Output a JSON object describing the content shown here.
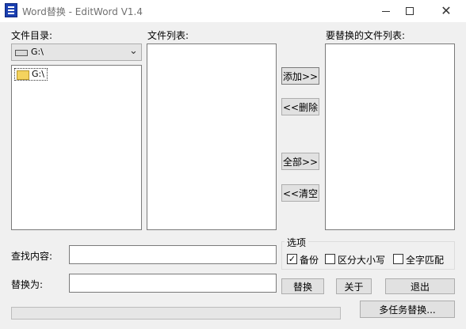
{
  "window": {
    "title": "Word替换 - EditWord V1.4"
  },
  "labels": {
    "file_dir": "文件目录:",
    "file_list": "文件列表:",
    "replace_list": "要替换的文件列表:",
    "find": "查找内容:",
    "replace_with": "替换为:"
  },
  "drive": {
    "selected": "G:\\",
    "folder": "G:\\"
  },
  "inputs": {
    "find_value": "",
    "replace_value": ""
  },
  "buttons": {
    "add": "添加>>",
    "delete": "<<删除",
    "all": "全部>>",
    "clear": "<<清空",
    "replace": "替换",
    "about": "关于",
    "exit": "退出",
    "multi": "多任务替换..."
  },
  "options": {
    "title": "选项",
    "backup": "备份",
    "backup_checked": true,
    "case": "区分大小写",
    "case_checked": false,
    "whole": "全字匹配",
    "whole_checked": false
  },
  "progress": {
    "value": 0
  },
  "icons": {
    "app": "editword-app-icon",
    "drive": "drive-icon",
    "folder": "folder-icon",
    "combo_arrow": "chevron-down-icon",
    "check": "✓"
  }
}
